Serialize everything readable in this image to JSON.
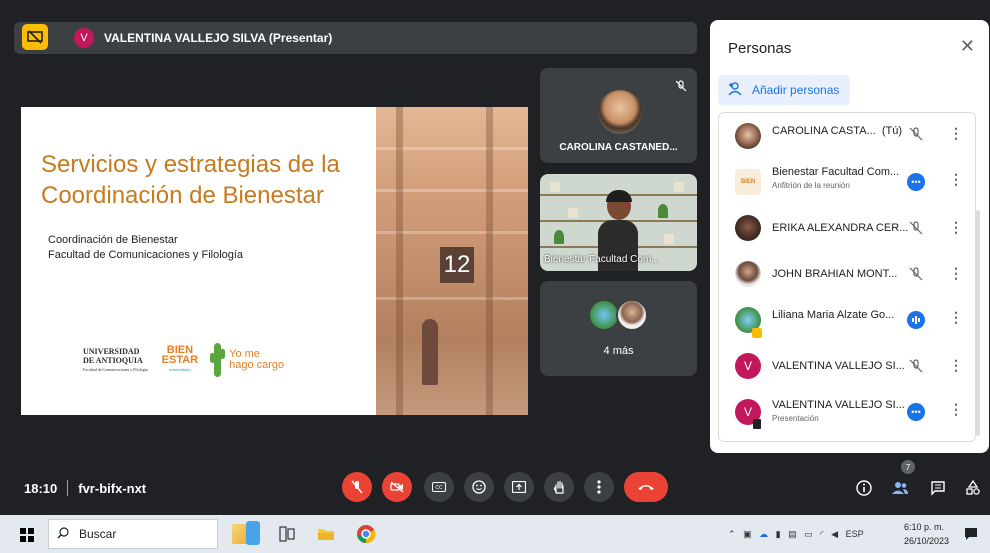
{
  "presenter": {
    "initial": "V",
    "name": "VALENTINA VALLEJO SILVA (Presentar)"
  },
  "slide": {
    "title": "Servicios y estrategias de la Coordinación de Bienestar",
    "subtitle_line1": "Coordinación de Bienestar",
    "subtitle_line2": "Facultad de Comunicaciones y Filología",
    "building_number": "12",
    "logo_udea_1": "UNIVERSIDAD",
    "logo_udea_2": "DE ANTIOQUIA",
    "logo_udea_3": "Facultad de Comunicaciones y Filología",
    "logo_bien_1": "BIEN",
    "logo_bien_2": "ESTAR",
    "logo_bien_3": "universitario",
    "logo_yome_1": "Yo me",
    "logo_yome_2": "hago cargo"
  },
  "tiles": {
    "tile1_name": "CAROLINA CASTANED...",
    "tile2_name": "Bienestar Facultad Com...",
    "tile3_more": "4 más"
  },
  "meeting": {
    "time": "18:10",
    "code": "fvr-bifx-nxt",
    "participant_count": "7"
  },
  "panel": {
    "title": "Personas",
    "add_label": "Añadir personas",
    "participants": [
      {
        "name": "CAROLINA CASTA...",
        "tag": "(Tú)",
        "sub": "",
        "state": "muted",
        "avatar_color": "#8d6e63"
      },
      {
        "name": "Bienestar Facultad Com...",
        "tag": "",
        "sub": "Anfitrión de la reunión",
        "state": "more",
        "avatar_color": "#f5e6c8"
      },
      {
        "name": "ERIKA ALEXANDRA CER...",
        "tag": "",
        "sub": "",
        "state": "muted",
        "avatar_color": "#5d4037"
      },
      {
        "name": "JOHN BRAHIAN MONT...",
        "tag": "",
        "sub": "",
        "state": "muted",
        "avatar_color": "#a1887f"
      },
      {
        "name": "Liliana Maria Alzate Go...",
        "tag": "",
        "sub": "",
        "state": "speaking",
        "avatar_color": "#4caf50"
      },
      {
        "name": "VALENTINA VALLEJO SI...",
        "tag": "",
        "sub": "",
        "state": "muted",
        "avatar_color": "#c2185b",
        "initial": "V"
      },
      {
        "name": "VALENTINA VALLEJO SI...",
        "tag": "",
        "sub": "Presentación",
        "state": "more",
        "avatar_color": "#c2185b",
        "initial": "V"
      }
    ]
  },
  "taskbar": {
    "search_label": "Buscar",
    "language": "ESP",
    "clock_time": "6:10 p. m.",
    "clock_date": "26/10/2023"
  }
}
